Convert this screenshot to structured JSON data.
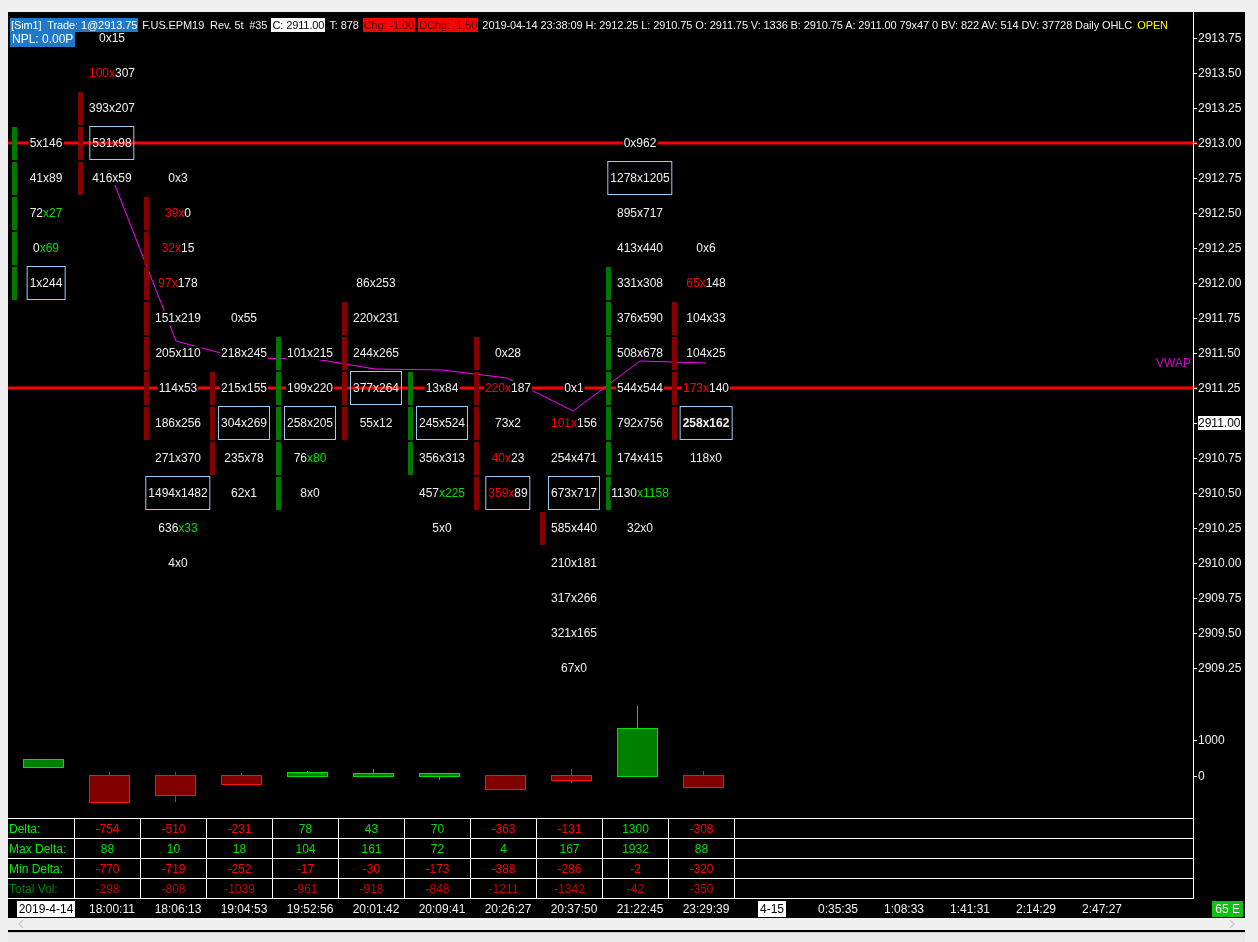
{
  "header": {
    "items": [
      {
        "text": "[Sim1]  Trade: 1@2913.75",
        "kind": "account"
      },
      {
        "text": "F.US.EPM19  Rev. 5t  #35",
        "kind": "plain"
      },
      {
        "text": "C: 2911.00",
        "kind": "price"
      },
      {
        "text": "T: 878",
        "kind": "plain"
      },
      {
        "text": "Chg: -1.00",
        "kind": "change"
      },
      {
        "text": "DChg: -1.50",
        "kind": "change"
      },
      {
        "text": "2019-04-14 23:38:09 H: 2912.25 L: 2910.75 O: 2911.75 V: 1336 B: 2910.75 A: 2911.00 79x47 0 BV: 822 AV: 514 DV: 37728 Daily OHLC",
        "kind": "plain"
      },
      {
        "text": "OPEN",
        "kind": "status"
      }
    ],
    "npl": "NPL: 0.00P"
  },
  "columns": [
    {
      "rising": true
    },
    {
      "rising": false
    },
    {
      "rising": false
    },
    {
      "rising": false
    },
    {
      "rising": true
    },
    {
      "rising": false
    },
    {
      "rising": true
    },
    {
      "rising": false
    },
    {
      "rising": false
    },
    {
      "rising": true
    },
    {
      "rising": false
    }
  ],
  "price_rows": [
    {
      "price": "2913.75",
      "level_line": false,
      "current": false,
      "cells": [
        null,
        {
          "lead": "0x15",
          "imbalance_bid": false,
          "imbalance_ask": false,
          "boxed": false,
          "body": false,
          "bold": false
        },
        null,
        null,
        null,
        null,
        null,
        null,
        null,
        null,
        null
      ]
    },
    {
      "price": "2913.50",
      "level_line": false,
      "current": false,
      "cells": [
        null,
        {
          "lead": "100x",
          "tail": "307",
          "imbalance_bid": true,
          "imbalance_ask": false,
          "boxed": false,
          "body": false,
          "bold": false
        },
        null,
        null,
        null,
        null,
        null,
        null,
        null,
        null,
        null
      ]
    },
    {
      "price": "2913.25",
      "level_line": false,
      "current": false,
      "cells": [
        null,
        {
          "lead": "393x207",
          "imbalance_bid": false,
          "imbalance_ask": false,
          "boxed": false,
          "body": true,
          "bold": false
        },
        null,
        null,
        null,
        null,
        null,
        null,
        null,
        null,
        null
      ]
    },
    {
      "price": "2913.00",
      "level_line": true,
      "current": false,
      "cells": [
        {
          "lead": "5x146",
          "imbalance_bid": false,
          "imbalance_ask": false,
          "boxed": false,
          "body": true,
          "bold": false
        },
        {
          "lead": "531x98",
          "imbalance_bid": false,
          "imbalance_ask": false,
          "boxed": true,
          "body": true,
          "bold": false
        },
        null,
        null,
        null,
        null,
        null,
        null,
        null,
        {
          "lead": "0x962",
          "imbalance_bid": false,
          "imbalance_ask": false,
          "boxed": false,
          "body": false,
          "bold": false
        },
        null
      ]
    },
    {
      "price": "2912.75",
      "level_line": false,
      "current": false,
      "cells": [
        {
          "lead": "41x89",
          "imbalance_bid": false,
          "imbalance_ask": false,
          "boxed": false,
          "body": true,
          "bold": false
        },
        {
          "lead": "416x59",
          "imbalance_bid": false,
          "imbalance_ask": false,
          "boxed": false,
          "body": true,
          "bold": false
        },
        {
          "lead": "0x3",
          "imbalance_bid": false,
          "imbalance_ask": false,
          "boxed": false,
          "body": false,
          "bold": false
        },
        null,
        null,
        null,
        null,
        null,
        null,
        {
          "lead": "1278x1205",
          "imbalance_bid": false,
          "imbalance_ask": false,
          "boxed": true,
          "body": false,
          "bold": false
        },
        null
      ]
    },
    {
      "price": "2912.50",
      "level_line": false,
      "current": false,
      "cells": [
        {
          "lead": "72",
          "tail": "x27",
          "imbalance_bid": false,
          "imbalance_ask": true,
          "boxed": false,
          "body": true,
          "bold": false
        },
        null,
        {
          "lead": "39x",
          "tail": "0",
          "imbalance_bid": true,
          "imbalance_ask": false,
          "boxed": false,
          "body": true,
          "bold": false
        },
        null,
        null,
        null,
        null,
        null,
        null,
        {
          "lead": "895x717",
          "imbalance_bid": false,
          "imbalance_ask": false,
          "boxed": false,
          "body": false,
          "bold": false
        },
        null
      ]
    },
    {
      "price": "2912.25",
      "level_line": false,
      "current": false,
      "cells": [
        {
          "lead": "0",
          "tail": "x69",
          "imbalance_bid": false,
          "imbalance_ask": true,
          "boxed": false,
          "body": true,
          "bold": false
        },
        null,
        {
          "lead": "32x",
          "tail": "15",
          "imbalance_bid": true,
          "imbalance_ask": false,
          "boxed": false,
          "body": true,
          "bold": false
        },
        null,
        null,
        null,
        null,
        null,
        null,
        {
          "lead": "413x440",
          "imbalance_bid": false,
          "imbalance_ask": false,
          "boxed": false,
          "body": false,
          "bold": false
        },
        {
          "lead": "0x6",
          "imbalance_bid": false,
          "imbalance_ask": false,
          "boxed": false,
          "body": false,
          "bold": false
        }
      ]
    },
    {
      "price": "2912.00",
      "level_line": false,
      "current": false,
      "cells": [
        {
          "lead": "1x244",
          "imbalance_bid": false,
          "imbalance_ask": false,
          "boxed": true,
          "body": true,
          "bold": false
        },
        null,
        {
          "lead": "97x",
          "tail": "178",
          "imbalance_bid": true,
          "imbalance_ask": false,
          "boxed": false,
          "body": true,
          "bold": false
        },
        null,
        null,
        {
          "lead": "86x253",
          "imbalance_bid": false,
          "imbalance_ask": false,
          "boxed": false,
          "body": false,
          "bold": false
        },
        null,
        null,
        null,
        {
          "lead": "331x308",
          "imbalance_bid": false,
          "imbalance_ask": false,
          "boxed": false,
          "body": true,
          "bold": false
        },
        {
          "lead": "65x",
          "tail": "148",
          "imbalance_bid": true,
          "imbalance_ask": false,
          "boxed": false,
          "body": false,
          "bold": false
        }
      ]
    },
    {
      "price": "2911.75",
      "level_line": false,
      "current": false,
      "cells": [
        null,
        null,
        {
          "lead": "151x219",
          "imbalance_bid": false,
          "imbalance_ask": false,
          "boxed": false,
          "body": true,
          "bold": false
        },
        {
          "lead": "0x55",
          "imbalance_bid": false,
          "imbalance_ask": false,
          "boxed": false,
          "body": false,
          "bold": false
        },
        null,
        {
          "lead": "220x231",
          "imbalance_bid": false,
          "imbalance_ask": false,
          "boxed": false,
          "body": true,
          "bold": false
        },
        null,
        null,
        null,
        {
          "lead": "376x590",
          "imbalance_bid": false,
          "imbalance_ask": false,
          "boxed": false,
          "body": true,
          "bold": false
        },
        {
          "lead": "104x33",
          "imbalance_bid": false,
          "imbalance_ask": false,
          "boxed": false,
          "body": true,
          "bold": false
        }
      ]
    },
    {
      "price": "2911.50",
      "level_line": false,
      "current": false,
      "cells": [
        null,
        null,
        {
          "lead": "205x110",
          "imbalance_bid": false,
          "imbalance_ask": false,
          "boxed": false,
          "body": true,
          "bold": false
        },
        {
          "lead": "218x245",
          "imbalance_bid": false,
          "imbalance_ask": false,
          "boxed": false,
          "body": false,
          "bold": false
        },
        {
          "lead": "101x215",
          "imbalance_bid": false,
          "imbalance_ask": false,
          "boxed": false,
          "body": true,
          "bold": false
        },
        {
          "lead": "244x265",
          "imbalance_bid": false,
          "imbalance_ask": false,
          "boxed": false,
          "body": true,
          "bold": false
        },
        null,
        {
          "lead": "0x28",
          "imbalance_bid": false,
          "imbalance_ask": false,
          "boxed": false,
          "body": true,
          "bold": false
        },
        null,
        {
          "lead": "508x678",
          "imbalance_bid": false,
          "imbalance_ask": false,
          "boxed": false,
          "body": true,
          "bold": false
        },
        {
          "lead": "104x25",
          "imbalance_bid": false,
          "imbalance_ask": false,
          "boxed": false,
          "body": true,
          "bold": false
        }
      ]
    },
    {
      "price": "2911.25",
      "level_line": true,
      "current": false,
      "cells": [
        null,
        null,
        {
          "lead": "114x53",
          "imbalance_bid": false,
          "imbalance_ask": false,
          "boxed": false,
          "body": true,
          "bold": false
        },
        {
          "lead": "215x155",
          "imbalance_bid": false,
          "imbalance_ask": false,
          "boxed": false,
          "body": true,
          "bold": false
        },
        {
          "lead": "199x220",
          "imbalance_bid": false,
          "imbalance_ask": false,
          "boxed": false,
          "body": true,
          "bold": false
        },
        {
          "lead": "377x264",
          "imbalance_bid": false,
          "imbalance_ask": false,
          "boxed": true,
          "body": true,
          "bold": false
        },
        {
          "lead": "13x84",
          "imbalance_bid": false,
          "imbalance_ask": false,
          "boxed": false,
          "body": true,
          "bold": false
        },
        {
          "lead": "220x",
          "tail": "187",
          "imbalance_bid": true,
          "imbalance_ask": false,
          "boxed": false,
          "body": true,
          "bold": false
        },
        {
          "lead": "0x1",
          "imbalance_bid": false,
          "imbalance_ask": false,
          "boxed": false,
          "body": false,
          "bold": false
        },
        {
          "lead": "544x544",
          "imbalance_bid": false,
          "imbalance_ask": false,
          "boxed": false,
          "body": true,
          "bold": false
        },
        {
          "lead": "173x",
          "tail": "140",
          "imbalance_bid": true,
          "imbalance_ask": false,
          "boxed": false,
          "body": true,
          "bold": false
        }
      ]
    },
    {
      "price": "2911.00",
      "level_line": false,
      "current": true,
      "cells": [
        null,
        null,
        {
          "lead": "186x256",
          "imbalance_bid": false,
          "imbalance_ask": false,
          "boxed": false,
          "body": true,
          "bold": false
        },
        {
          "lead": "304x269",
          "imbalance_bid": false,
          "imbalance_ask": false,
          "boxed": true,
          "body": true,
          "bold": false
        },
        {
          "lead": "258x205",
          "imbalance_bid": false,
          "imbalance_ask": false,
          "boxed": true,
          "body": true,
          "bold": false
        },
        {
          "lead": "55x12",
          "imbalance_bid": false,
          "imbalance_ask": false,
          "boxed": false,
          "body": true,
          "bold": false
        },
        {
          "lead": "245x524",
          "imbalance_bid": false,
          "imbalance_ask": false,
          "boxed": true,
          "body": true,
          "bold": false
        },
        {
          "lead": "73x2",
          "imbalance_bid": false,
          "imbalance_ask": false,
          "boxed": false,
          "body": true,
          "bold": false
        },
        {
          "lead": "101x",
          "tail": "156",
          "imbalance_bid": true,
          "imbalance_ask": false,
          "boxed": false,
          "body": false,
          "bold": false
        },
        {
          "lead": "792x756",
          "imbalance_bid": false,
          "imbalance_ask": false,
          "boxed": false,
          "body": true,
          "bold": false
        },
        {
          "lead": "258x162",
          "imbalance_bid": false,
          "imbalance_ask": false,
          "boxed": true,
          "body": true,
          "bold": true
        }
      ]
    },
    {
      "price": "2910.75",
      "level_line": false,
      "current": false,
      "cells": [
        null,
        null,
        {
          "lead": "271x370",
          "imbalance_bid": false,
          "imbalance_ask": false,
          "boxed": false,
          "body": false,
          "bold": false
        },
        {
          "lead": "235x78",
          "imbalance_bid": false,
          "imbalance_ask": false,
          "boxed": false,
          "body": true,
          "bold": false
        },
        {
          "lead": "76",
          "tail": "x80",
          "imbalance_bid": false,
          "imbalance_ask": true,
          "boxed": false,
          "body": true,
          "bold": false
        },
        null,
        {
          "lead": "356x313",
          "imbalance_bid": false,
          "imbalance_ask": false,
          "boxed": false,
          "body": true,
          "bold": false
        },
        {
          "lead": "40x",
          "tail": "23",
          "imbalance_bid": true,
          "imbalance_ask": false,
          "boxed": false,
          "body": true,
          "bold": false
        },
        {
          "lead": "254x471",
          "imbalance_bid": false,
          "imbalance_ask": false,
          "boxed": false,
          "body": false,
          "bold": false
        },
        {
          "lead": "174x415",
          "imbalance_bid": false,
          "imbalance_ask": false,
          "boxed": false,
          "body": true,
          "bold": false
        },
        {
          "lead": "118x0",
          "imbalance_bid": false,
          "imbalance_ask": false,
          "boxed": false,
          "body": false,
          "bold": false
        }
      ]
    },
    {
      "price": "2910.50",
      "level_line": false,
      "current": false,
      "cells": [
        null,
        null,
        {
          "lead": "1494x1482",
          "imbalance_bid": false,
          "imbalance_ask": false,
          "boxed": true,
          "body": false,
          "bold": false
        },
        {
          "lead": "62x1",
          "imbalance_bid": false,
          "imbalance_ask": false,
          "boxed": false,
          "body": false,
          "bold": false
        },
        {
          "lead": "8x0",
          "imbalance_bid": false,
          "imbalance_ask": false,
          "boxed": false,
          "body": true,
          "bold": false
        },
        null,
        {
          "lead": "457",
          "tail": "x225",
          "imbalance_bid": false,
          "imbalance_ask": true,
          "boxed": false,
          "body": false,
          "bold": false
        },
        {
          "lead": "359x",
          "tail": "89",
          "imbalance_bid": true,
          "imbalance_ask": false,
          "boxed": true,
          "body": true,
          "bold": false
        },
        {
          "lead": "673x717",
          "imbalance_bid": false,
          "imbalance_ask": false,
          "boxed": true,
          "body": false,
          "bold": false
        },
        {
          "lead": "1130",
          "tail": "x1158",
          "imbalance_bid": false,
          "imbalance_ask": true,
          "boxed": false,
          "body": true,
          "bold": false
        },
        null
      ]
    },
    {
      "price": "2910.25",
      "level_line": false,
      "current": false,
      "cells": [
        null,
        null,
        {
          "lead": "636",
          "tail": "x33",
          "imbalance_bid": false,
          "imbalance_ask": true,
          "boxed": false,
          "body": false,
          "bold": false
        },
        null,
        null,
        null,
        {
          "lead": "5x0",
          "imbalance_bid": false,
          "imbalance_ask": false,
          "boxed": false,
          "body": false,
          "bold": false
        },
        null,
        {
          "lead": "585x440",
          "imbalance_bid": false,
          "imbalance_ask": false,
          "boxed": false,
          "body": true,
          "bold": false
        },
        {
          "lead": "32x0",
          "imbalance_bid": false,
          "imbalance_ask": false,
          "boxed": false,
          "body": false,
          "bold": false
        },
        null
      ]
    },
    {
      "price": "2910.00",
      "level_line": false,
      "current": false,
      "cells": [
        null,
        null,
        {
          "lead": "4x0",
          "imbalance_bid": false,
          "imbalance_ask": false,
          "boxed": false,
          "body": false,
          "bold": false
        },
        null,
        null,
        null,
        null,
        null,
        {
          "lead": "210x181",
          "imbalance_bid": false,
          "imbalance_ask": false,
          "boxed": false,
          "body": false,
          "bold": false
        },
        null,
        null
      ]
    },
    {
      "price": "2909.75",
      "level_line": false,
      "current": false,
      "cells": [
        null,
        null,
        null,
        null,
        null,
        null,
        null,
        null,
        {
          "lead": "317x266",
          "imbalance_bid": false,
          "imbalance_ask": false,
          "boxed": false,
          "body": false,
          "bold": false
        },
        null,
        null
      ]
    },
    {
      "price": "2909.50",
      "level_line": false,
      "current": false,
      "cells": [
        null,
        null,
        null,
        null,
        null,
        null,
        null,
        null,
        {
          "lead": "321x165",
          "imbalance_bid": false,
          "imbalance_ask": false,
          "boxed": false,
          "body": false,
          "bold": false
        },
        null,
        null
      ]
    },
    {
      "price": "2909.25",
      "level_line": false,
      "current": false,
      "cells": [
        null,
        null,
        null,
        null,
        null,
        null,
        null,
        null,
        {
          "lead": "67x0",
          "imbalance_bid": false,
          "imbalance_ask": false,
          "boxed": false,
          "body": false,
          "bold": false
        },
        null,
        null
      ]
    }
  ],
  "vwap_label": "VWAP",
  "volume_axis": [
    "1000",
    "0"
  ],
  "stats": {
    "rows": [
      {
        "label": "Delta:",
        "dim": false,
        "values": [
          {
            "text": "-754",
            "positive": false
          },
          {
            "text": "-510",
            "positive": false
          },
          {
            "text": "-231",
            "positive": false
          },
          {
            "text": "78",
            "positive": true
          },
          {
            "text": "43",
            "positive": true
          },
          {
            "text": "70",
            "positive": true
          },
          {
            "text": "-363",
            "positive": false
          },
          {
            "text": "-131",
            "positive": false
          },
          {
            "text": "1300",
            "positive": true
          },
          {
            "text": "-308",
            "positive": false
          }
        ]
      },
      {
        "label": "Max Delta:",
        "dim": false,
        "values": [
          {
            "text": "88",
            "positive": true
          },
          {
            "text": "10",
            "positive": true
          },
          {
            "text": "18",
            "positive": true
          },
          {
            "text": "104",
            "positive": true
          },
          {
            "text": "161",
            "positive": true
          },
          {
            "text": "72",
            "positive": true
          },
          {
            "text": "4",
            "positive": true
          },
          {
            "text": "167",
            "positive": true
          },
          {
            "text": "1932",
            "positive": true
          },
          {
            "text": "88",
            "positive": true
          }
        ]
      },
      {
        "label": "Min Delta:",
        "dim": false,
        "values": [
          {
            "text": "-770",
            "positive": false
          },
          {
            "text": "-719",
            "positive": false
          },
          {
            "text": "-252",
            "positive": false
          },
          {
            "text": "-17",
            "positive": false
          },
          {
            "text": "-30",
            "positive": false
          },
          {
            "text": "-173",
            "positive": false
          },
          {
            "text": "-388",
            "positive": false
          },
          {
            "text": "-286",
            "positive": false
          },
          {
            "text": "-2",
            "positive": false
          },
          {
            "text": "-320",
            "positive": false
          }
        ]
      },
      {
        "label": "Total Vol:",
        "dim": true,
        "values": [
          {
            "text": "-298",
            "positive": false
          },
          {
            "text": "-808",
            "positive": false
          },
          {
            "text": "-1039",
            "positive": false
          },
          {
            "text": "-961",
            "positive": false
          },
          {
            "text": "-918",
            "positive": false
          },
          {
            "text": "-848",
            "positive": false
          },
          {
            "text": "-1211",
            "positive": false
          },
          {
            "text": "-1342",
            "positive": false
          },
          {
            "text": "-42",
            "positive": false
          },
          {
            "text": "-350",
            "positive": false
          }
        ]
      }
    ]
  },
  "time_axis": [
    {
      "text": "2019-4-14",
      "date": true
    },
    {
      "text": "18:00:11",
      "date": false
    },
    {
      "text": "18:06:13",
      "date": false
    },
    {
      "text": "19:04:53",
      "date": false
    },
    {
      "text": "19:52:56",
      "date": false
    },
    {
      "text": "20:01:42",
      "date": false
    },
    {
      "text": "20:09:41",
      "date": false
    },
    {
      "text": "20:26:27",
      "date": false
    },
    {
      "text": "20:37:50",
      "date": false
    },
    {
      "text": "21:22:45",
      "date": false
    },
    {
      "text": "23:29:39",
      "date": false
    },
    {
      "text": "4-15",
      "date": true
    },
    {
      "text": "0:35:35",
      "date": false
    },
    {
      "text": "1:08:33",
      "date": false
    },
    {
      "text": "1:41:31",
      "date": false
    },
    {
      "text": "2:14:29",
      "date": false
    },
    {
      "text": "2:47:27",
      "date": false
    }
  ],
  "badge": "65 E"
}
